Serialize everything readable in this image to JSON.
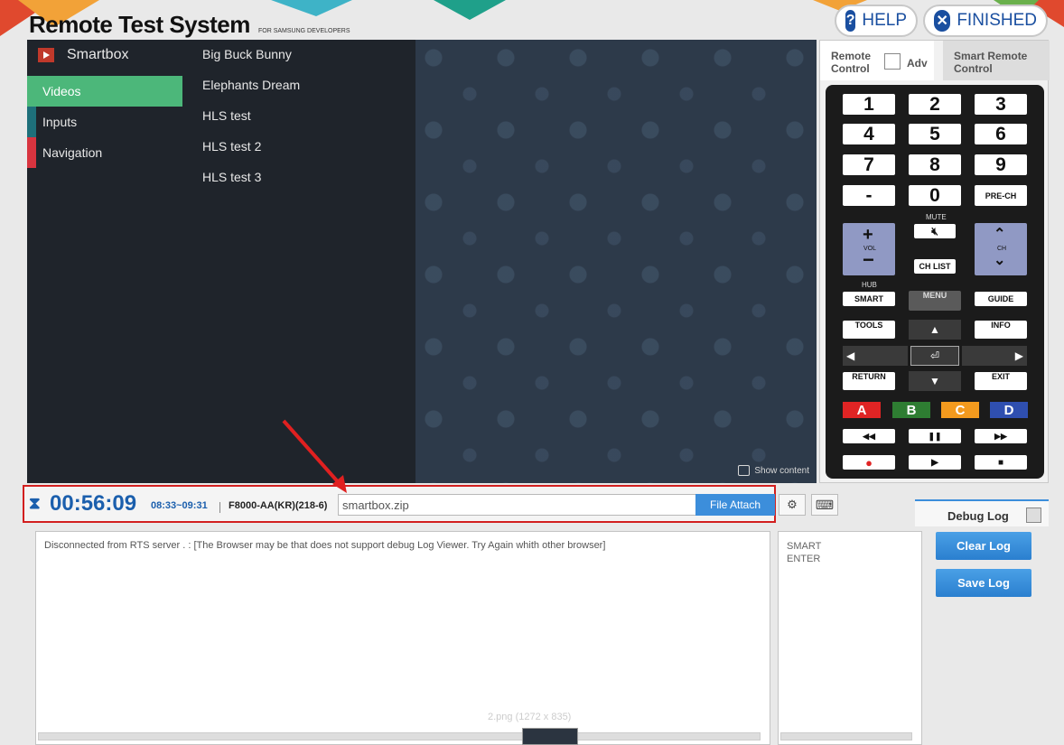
{
  "header": {
    "title": "Remote Test System",
    "subtitle": "FOR SAMSUNG DEVELOPERS",
    "help_label": "HELP",
    "finished_label": "FINISHED"
  },
  "tv": {
    "app_name": "Smartbox",
    "categories": [
      {
        "label": "Videos",
        "active": true
      },
      {
        "label": "Inputs",
        "active": false
      },
      {
        "label": "Navigation",
        "active": false
      }
    ],
    "items": [
      "Big Buck Bunny",
      "Elephants Dream",
      "HLS test",
      "HLS test 2",
      "HLS test 3"
    ],
    "show_content": "Show content"
  },
  "remote": {
    "tab_remote": "Remote Control",
    "tab_adv": "Adv",
    "tab_smart": "Smart Remote Control",
    "numbers": [
      "1",
      "2",
      "3",
      "4",
      "5",
      "6",
      "7",
      "8",
      "9",
      "-",
      "0"
    ],
    "prech": "PRE-CH",
    "mute": "MUTE",
    "vol": "VOL",
    "ch": "CH",
    "chlist": "CH LIST",
    "hub": "HUB",
    "smart": "SMART",
    "menu": "MENU",
    "guide": "GUIDE",
    "tools": "TOOLS",
    "info": "INFO",
    "return": "RETURN",
    "exit": "EXIT",
    "color_keys": [
      {
        "label": "A",
        "color": "#e02424"
      },
      {
        "label": "B",
        "color": "#2e7d32"
      },
      {
        "label": "C",
        "color": "#f39a1e"
      },
      {
        "label": "D",
        "color": "#2f4fb0"
      }
    ]
  },
  "control_bar": {
    "timer": "00:56:09",
    "time_range": "08:33~09:31",
    "device": "F8000-AA(KR)(218-6)",
    "file_value": "smartbox.zip",
    "file_attach": "File Attach"
  },
  "debug": {
    "tab_label": "Debug Log",
    "message": "Disconnected from RTS server . : [The Browser may be that does not support debug Log Viewer. Try Again whith other browser]",
    "key_log": [
      "SMART",
      "ENTER"
    ],
    "clear_log": "Clear Log",
    "save_log": "Save Log"
  },
  "overlay": {
    "caption": "2.png (1272 x 835)"
  },
  "colors": {
    "accent": "#1b5fad",
    "highlight_border": "#d21f1f",
    "menu_active": "#4cb77a"
  }
}
